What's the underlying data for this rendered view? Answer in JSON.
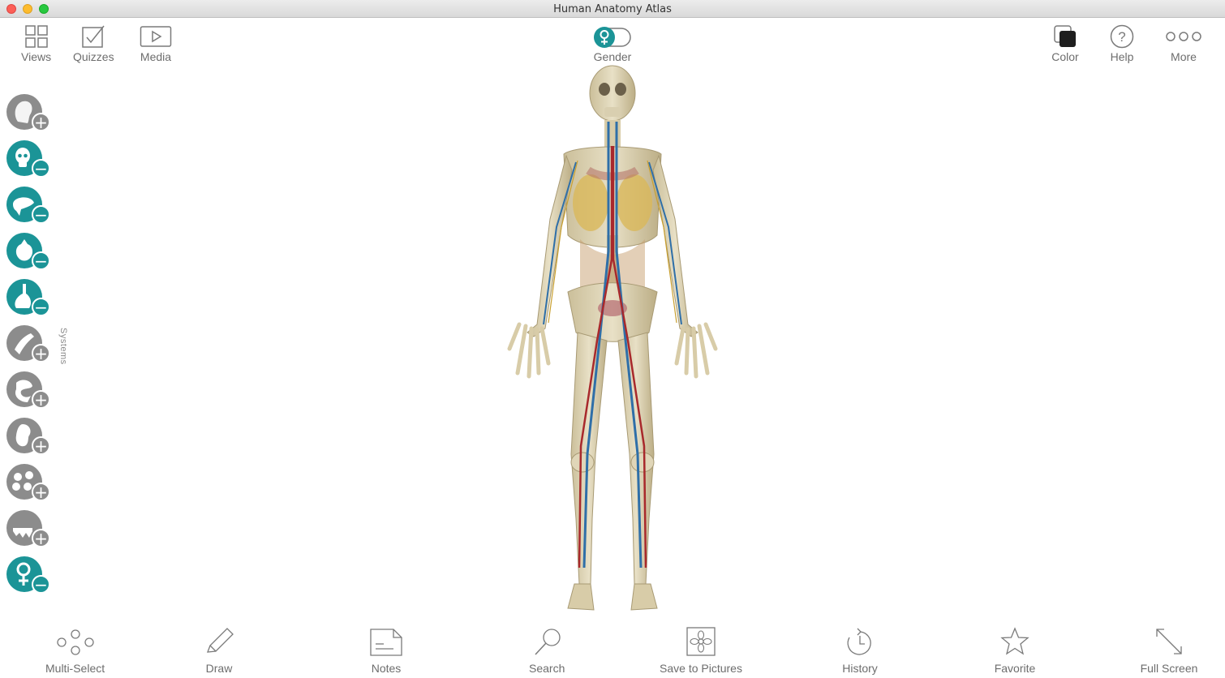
{
  "window": {
    "title": "Human Anatomy Atlas"
  },
  "top_toolbar": {
    "views": "Views",
    "quizzes": "Quizzes",
    "media": "Media",
    "gender": "Gender",
    "color": "Color",
    "help": "Help",
    "more": "More"
  },
  "sidebar": {
    "label": "Systems",
    "items": [
      {
        "name": "skin",
        "state": "+",
        "active": false
      },
      {
        "name": "skeletal",
        "state": "−",
        "active": true
      },
      {
        "name": "nervous",
        "state": "−",
        "active": true
      },
      {
        "name": "cardiovascular",
        "state": "−",
        "active": true
      },
      {
        "name": "lymphatic",
        "state": "−",
        "active": true
      },
      {
        "name": "muscular",
        "state": "+",
        "active": false
      },
      {
        "name": "digestive",
        "state": "+",
        "active": false
      },
      {
        "name": "urinary",
        "state": "+",
        "active": false
      },
      {
        "name": "respiratory",
        "state": "+",
        "active": false
      },
      {
        "name": "dental",
        "state": "+",
        "active": false
      },
      {
        "name": "reproductive",
        "state": "−",
        "active": true
      }
    ]
  },
  "bottom_toolbar": {
    "multi_select": "Multi-Select",
    "draw": "Draw",
    "notes": "Notes",
    "search": "Search",
    "save_to_pictures": "Save to Pictures",
    "history": "History",
    "favorite": "Favorite",
    "full_screen": "Full Screen"
  },
  "colors": {
    "accent": "#1b9497",
    "inactive": "#8c8c8c",
    "icon_gray": "#7a7a7a"
  }
}
